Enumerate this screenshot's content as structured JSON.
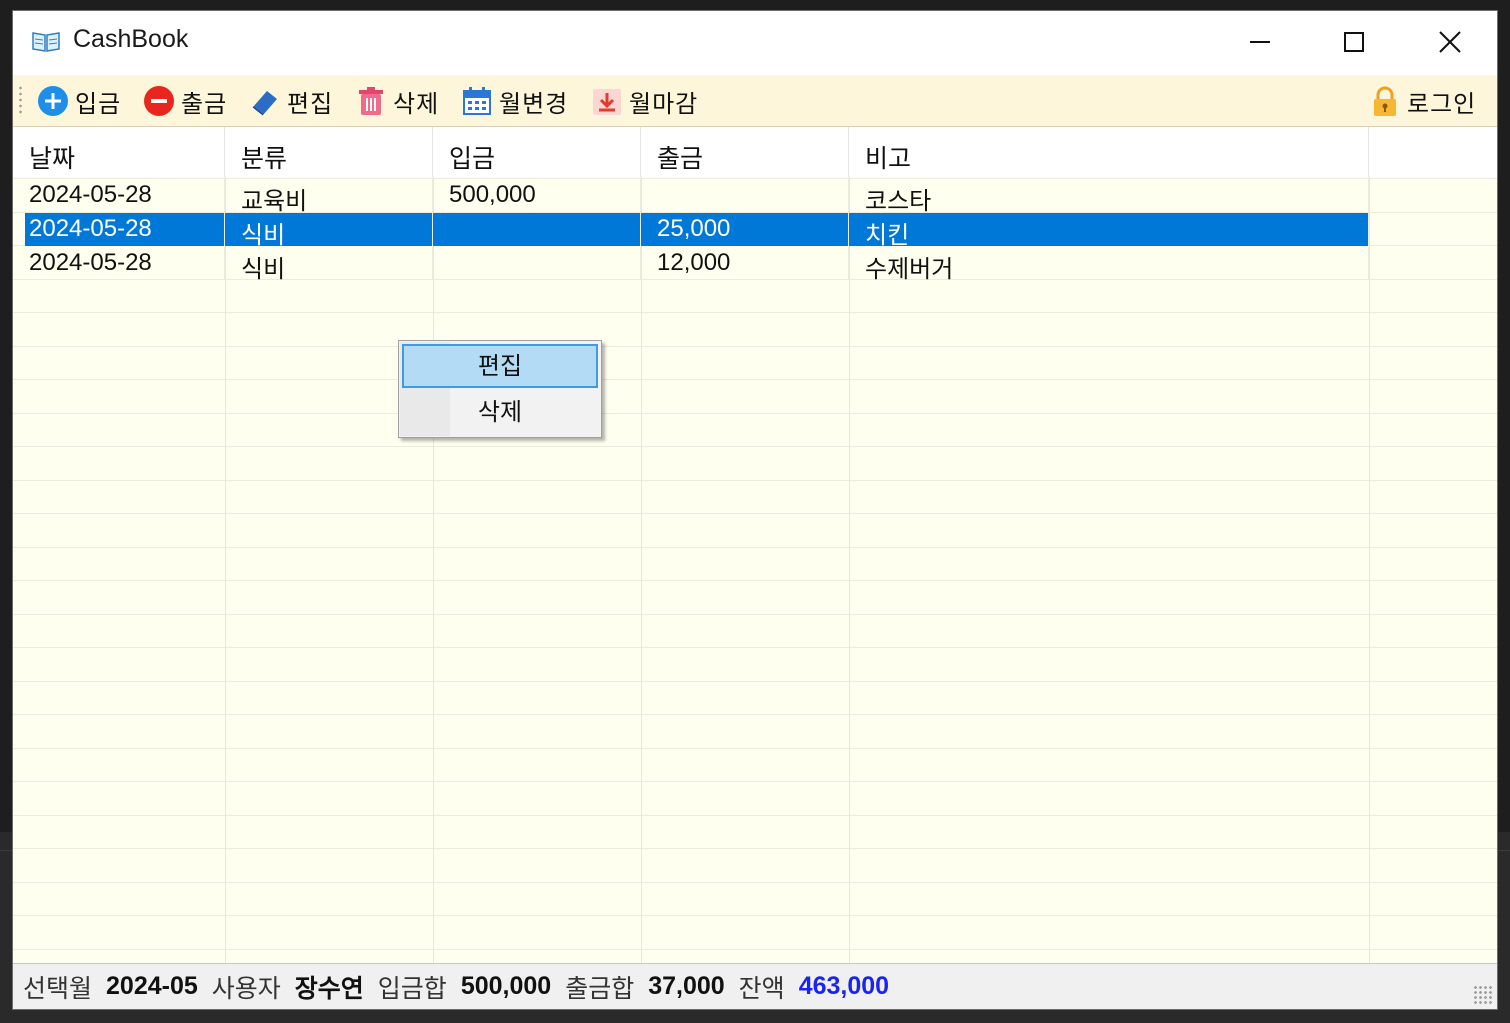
{
  "window": {
    "title": "CashBook"
  },
  "toolbar": {
    "items": [
      {
        "label": "입금",
        "icon": "plus-circle-icon"
      },
      {
        "label": "출금",
        "icon": "minus-circle-icon"
      },
      {
        "label": "편집",
        "icon": "eraser-icon"
      },
      {
        "label": "삭제",
        "icon": "trash-icon"
      },
      {
        "label": "월변경",
        "icon": "calendar-icon"
      },
      {
        "label": "월마감",
        "icon": "download-icon"
      }
    ],
    "login": {
      "label": "로그인",
      "icon": "lock-icon"
    }
  },
  "grid": {
    "columns": [
      "날짜",
      "분류",
      "입금",
      "출금",
      "비고"
    ],
    "rows": [
      {
        "date": "2024-05-28",
        "category": "교육비",
        "income": "500,000",
        "expense": "",
        "memo": "코스타",
        "selected": false
      },
      {
        "date": "2024-05-28",
        "category": "식비",
        "income": "",
        "expense": "25,000",
        "memo": "치킨",
        "selected": true
      },
      {
        "date": "2024-05-28",
        "category": "식비",
        "income": "",
        "expense": "12,000",
        "memo": "수제버거",
        "selected": false
      }
    ]
  },
  "context_menu": {
    "items": [
      {
        "label": "편집",
        "highlighted": true
      },
      {
        "label": "삭제",
        "highlighted": false
      }
    ]
  },
  "status": {
    "month_label": "선택월",
    "month_value": "2024-05",
    "user_label": "사용자",
    "user_value": "장수연",
    "income_label": "입금합",
    "income_value": "500,000",
    "expense_label": "출금합",
    "expense_value": "37,000",
    "balance_label": "잔액",
    "balance_value": "463,000"
  },
  "colors": {
    "accent": "#0078d7",
    "balance": "#1a24f0",
    "grid_bg": "#fffff0",
    "toolbar_bg": "#fdf6da"
  }
}
